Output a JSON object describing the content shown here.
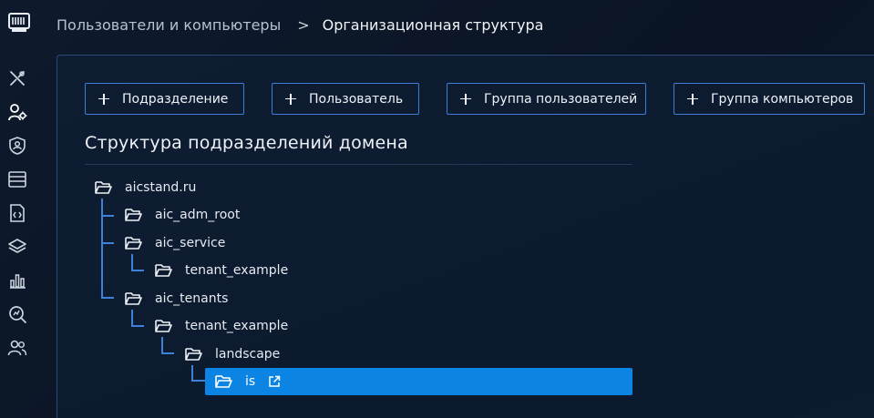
{
  "header": {
    "breadcrumb_root": "Пользователи и компьютеры",
    "breadcrumb_separator": ">",
    "breadcrumb_current": "Организационная структура"
  },
  "sidebar": {
    "items": [
      {
        "icon": "tools-icon"
      },
      {
        "icon": "user-settings-icon"
      },
      {
        "icon": "shield-user-icon"
      },
      {
        "icon": "window-icon"
      },
      {
        "icon": "code-file-icon"
      },
      {
        "icon": "layers-icon"
      },
      {
        "icon": "bar-chart-icon"
      },
      {
        "icon": "search-analytics-icon"
      },
      {
        "icon": "users-icon"
      }
    ]
  },
  "toolbar": {
    "add_ou_label": "Подразделение",
    "add_user_label": "Пользователь",
    "add_user_group_label": "Группа пользователей",
    "add_computer_group_label": "Группа компьютеров"
  },
  "section_title": "Структура подразделений домена",
  "tree": {
    "nodes": [
      {
        "label": "aicstand.ru",
        "depth": 0
      },
      {
        "label": "aic_adm_root",
        "depth": 1
      },
      {
        "label": "aic_service",
        "depth": 1
      },
      {
        "label": "tenant_example",
        "depth": 2
      },
      {
        "label": "aic_tenants",
        "depth": 1
      },
      {
        "label": "tenant_example",
        "depth": 2
      },
      {
        "label": "landscape",
        "depth": 3
      },
      {
        "label": "is",
        "depth": 4,
        "selected": true
      }
    ]
  },
  "colors": {
    "accent": "#3d7fd6",
    "selected": "#0c84e4",
    "background": "#0b1526"
  }
}
